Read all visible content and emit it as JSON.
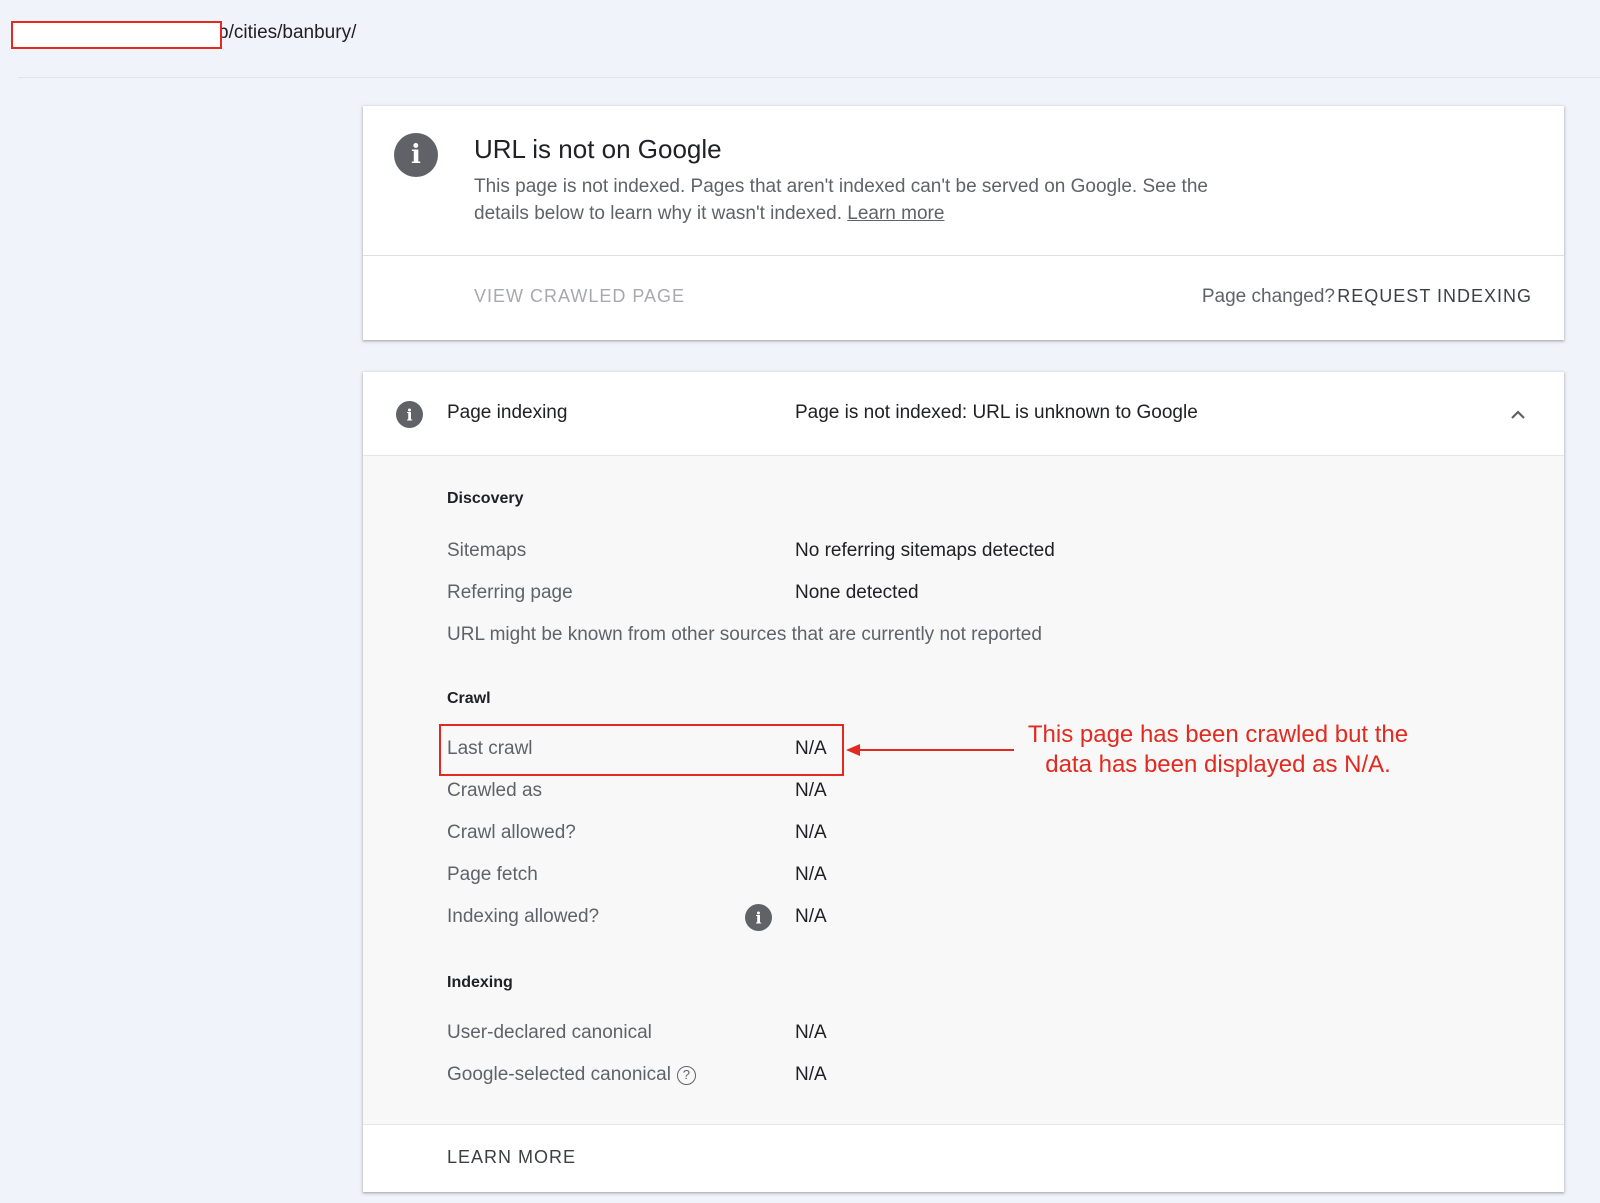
{
  "url_bar": {
    "path_text": "b/cities/banbury/"
  },
  "status_card": {
    "icon": "info-icon",
    "title": "URL is not on Google",
    "description": "This page is not indexed. Pages that aren't indexed can't be served on Google. See the details below to learn why it wasn't indexed.",
    "learn_more_link": "Learn more",
    "view_crawled_label": "VIEW CRAWLED PAGE",
    "page_changed_label": "Page changed?",
    "request_indexing_label": "REQUEST INDEXING"
  },
  "indexing_card": {
    "icon": "info-icon",
    "label": "Page indexing",
    "status": "Page is not indexed: URL is unknown to Google",
    "chevron": "chevron-up-icon",
    "discovery": {
      "title": "Discovery",
      "sitemaps_label": "Sitemaps",
      "sitemaps_value": "No referring sitemaps detected",
      "referring_label": "Referring page",
      "referring_value": "None detected",
      "note": "URL might be known from other sources that are currently not reported"
    },
    "crawl": {
      "title": "Crawl",
      "last_crawl_label": "Last crawl",
      "last_crawl_value": "N/A",
      "crawled_as_label": "Crawled as",
      "crawled_as_value": "N/A",
      "crawl_allowed_label": "Crawl allowed?",
      "crawl_allowed_value": "N/A",
      "page_fetch_label": "Page fetch",
      "page_fetch_value": "N/A",
      "indexing_allowed_label": "Indexing allowed?",
      "indexing_allowed_value": "N/A"
    },
    "indexing": {
      "title": "Indexing",
      "user_canonical_label": "User-declared canonical",
      "user_canonical_value": "N/A",
      "google_canonical_label": "Google-selected canonical",
      "google_canonical_value": "N/A",
      "help_glyph": "?"
    },
    "footer_learn_more": "LEARN MORE"
  },
  "annotation": {
    "text": "This page has been crawled but the data has been displayed as N/A.",
    "color": "#e22a20"
  },
  "info_glyph": "i"
}
